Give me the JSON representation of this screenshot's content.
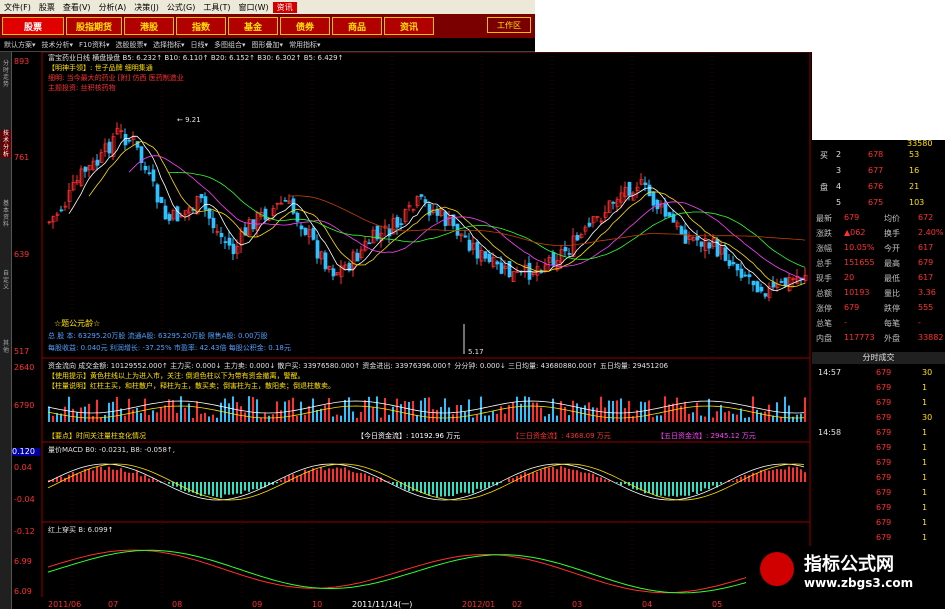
{
  "menu": {
    "items": [
      "文件(F)",
      "股票",
      "查看(V)",
      "分析(A)",
      "决策(J)",
      "公式(G)",
      "工具(T)",
      "窗口(W)",
      "资讯"
    ],
    "active_index": 8
  },
  "categories": [
    "股票",
    "股指期货",
    "港股",
    "指数",
    "基金",
    "债券",
    "商品",
    "资讯"
  ],
  "active_category": 0,
  "workarea": "工作区",
  "toolbar": [
    "默认方案",
    "技术分析",
    "F10资料",
    "选股股票",
    "选择指标",
    "日线",
    "多图组合",
    "图形叠加",
    "常用指标"
  ],
  "left_tabs": [
    "分时走势",
    "技术分析",
    "基本资料",
    "自定义",
    "其他"
  ],
  "chart_header": {
    "line1": "富宝药业日线 横盘操盘 B5: 6.232↑ B10: 6.110↑ B20: 6.152↑ B30: 6.302↑ B5: 6.429↑",
    "line2": "【明神手领】: 世子品牌 细明集通",
    "line3": "细明: 当今最大的药业 [附] 仿西 医药制造业",
    "line4": "主题投资: 丝积核药物"
  },
  "main_price_axis": [
    "893",
    "761",
    "639",
    "517"
  ],
  "annotations": {
    "high": "9.21",
    "low": "5.17",
    "formula_title": "☆题公元龄☆"
  },
  "stats_block": [
    "总 股 本: 63295.20万股  流通A股: 63295.20万股  限售A股: 0.00万股",
    "每股收益: 0.040元  利润增长: -37.25%  市盈率: 42.43倍  每股公积金: 0.18元"
  ],
  "fund_panel": {
    "header": "资金流向 成交金额: 10129552.000↑  主力买: 0.000↓  主力卖: 0.000↓  散户买: 33976580.000↑  资金进出: 33976396.000↑  分分钟: 0.000↓  三日均量: 43680880.000↑  五日均量: 29451206",
    "line2": "【使用提示】黄色柱线以上为进入市，关注: 倒退色柱以下为带有资金撤离，警醒。",
    "line3": "【柱量说明】红柱主买，和柱散户，释柱为主，散买卖；倒害柱为主，散阳卖；倒退柱散卖。",
    "axis": [
      "2640",
      "6790"
    ],
    "summary": "【要点】时间关注量柱变化情况",
    "today_fund": "【今日资金流】: 10192.96 万元",
    "three_day_fund": "【三日资金流】: 4368.09 万元",
    "five_day_fund": "【五日资金流】: 2945.12 万元"
  },
  "macd_panel": {
    "header": "量价MACD  B0: -0.0231, B8: -0.058↑,",
    "badge": "0.120",
    "axis": [
      "0.04",
      "-0.04",
      "-0.12"
    ]
  },
  "bottom_panel": {
    "header": "红上穿买  B: 6.099↑",
    "axis": [
      "6.99",
      "6.09"
    ]
  },
  "date_axis": [
    "2011/06",
    "07",
    "08",
    "09",
    "10",
    "2011/11/14(一)",
    "2012/01",
    "02",
    "03",
    "04",
    "05"
  ],
  "order_book": [
    {
      "side": "买",
      "level": "2",
      "price": "678",
      "vol": "53"
    },
    {
      "side": "",
      "level": "3",
      "price": "677",
      "vol": "16"
    },
    {
      "side": "盘",
      "level": "4",
      "price": "676",
      "vol": "21"
    },
    {
      "side": "",
      "level": "5",
      "price": "675",
      "vol": "103"
    }
  ],
  "order_book_top_vol": "33580",
  "quote": [
    {
      "l1": "最新",
      "v1": "679",
      "l2": "均价",
      "v2": "672"
    },
    {
      "l1": "涨跌",
      "v1": "▲062",
      "l2": "换手",
      "v2": "2.40%"
    },
    {
      "l1": "涨幅",
      "v1": "10.05%",
      "l2": "今开",
      "v2": "617"
    },
    {
      "l1": "总手",
      "v1": "151655",
      "l2": "最高",
      "v2": "679"
    },
    {
      "l1": "现手",
      "v1": "20",
      "l2": "最低",
      "v2": "617"
    },
    {
      "l1": "总额",
      "v1": "10193",
      "l2": "量比",
      "v2": "3.36"
    },
    {
      "l1": "涨停",
      "v1": "679",
      "l2": "跌停",
      "v2": "555"
    },
    {
      "l1": "总笔",
      "v1": "-",
      "l2": "每笔",
      "v2": "-"
    },
    {
      "l1": "内盘",
      "v1": "117773",
      "l2": "外盘",
      "v2": "33882"
    }
  ],
  "ticks_header": "分时成交",
  "ticks": [
    {
      "time": "14:57",
      "price": "679",
      "vol": "30"
    },
    {
      "time": "",
      "price": "679",
      "vol": "1"
    },
    {
      "time": "",
      "price": "679",
      "vol": "1"
    },
    {
      "time": "",
      "price": "679",
      "vol": "30"
    },
    {
      "time": "14:58",
      "price": "679",
      "vol": "1"
    },
    {
      "time": "",
      "price": "679",
      "vol": "1"
    },
    {
      "time": "",
      "price": "679",
      "vol": "1"
    },
    {
      "time": "",
      "price": "679",
      "vol": "1"
    },
    {
      "time": "",
      "price": "679",
      "vol": "1"
    },
    {
      "time": "",
      "price": "679",
      "vol": "1"
    },
    {
      "time": "",
      "price": "679",
      "vol": "1"
    },
    {
      "time": "",
      "price": "679",
      "vol": "1"
    },
    {
      "time": "",
      "price": "679",
      "vol": "1"
    },
    {
      "time": "14:59",
      "price": "679",
      "vol": "1"
    },
    {
      "time": "",
      "price": "679",
      "vol": "1"
    },
    {
      "time": "",
      "price": "679",
      "vol": "1"
    }
  ],
  "watermark": {
    "title": "指标公式网",
    "url": "www.zbgs3.com"
  },
  "colors": {
    "up": "#ff3030",
    "down": "#30c0ff",
    "yellow": "#ffe000",
    "grid": "#800000"
  }
}
